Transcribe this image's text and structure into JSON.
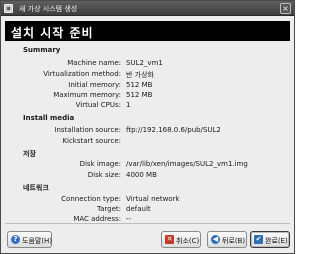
{
  "window": {
    "title": "새 가상 시스템 생성",
    "close_glyph": "×"
  },
  "banner": {
    "title": "설치 시작 준비"
  },
  "summary": {
    "heading": "Summary",
    "machine_name_label": "Machine name:",
    "machine_name_value": "SUL2_vm1",
    "virtualization_label": "Virtualization method:",
    "virtualization_value": "반 가상화",
    "initial_memory_label": "Initial memory:",
    "initial_memory_value": "512 MB",
    "maximum_memory_label": "Maximum memory:",
    "maximum_memory_value": "512 MB",
    "vcpus_label": "Virtual CPUs:",
    "vcpus_value": "1"
  },
  "install_media": {
    "heading": "Install media",
    "installation_source_label": "Installation source:",
    "installation_source_value": "ftp://192.168.0.6/pub/SUL2",
    "kickstart_source_label": "Kickstart source:",
    "kickstart_source_value": ""
  },
  "storage": {
    "heading": "저장",
    "disk_image_label": "Disk image:",
    "disk_image_value": "/var/lib/xen/images/SUL2_vm1.img",
    "disk_size_label": "Disk size:",
    "disk_size_value": "4000 MB"
  },
  "network": {
    "heading": "네트워크",
    "connection_type_label": "Connection type:",
    "connection_type_value": "Virtual network",
    "target_label": "Target:",
    "target_value": "default",
    "mac_address_label": "MAC address:",
    "mac_address_value": "--"
  },
  "buttons": {
    "help_label": "도움말(H)",
    "cancel_label": "취소(C)",
    "back_label": "뒤로(B)",
    "finish_label": "완료(E)"
  },
  "colors": {
    "banner_bg": "#000000",
    "titlebar_bg": "#4a4a4a",
    "window_bg": "#ededed",
    "help_icon": "#3a6fc4",
    "cancel_icon": "#c0392b",
    "back_icon": "#2f6fb5",
    "finish_icon": "#2f6fb5"
  }
}
